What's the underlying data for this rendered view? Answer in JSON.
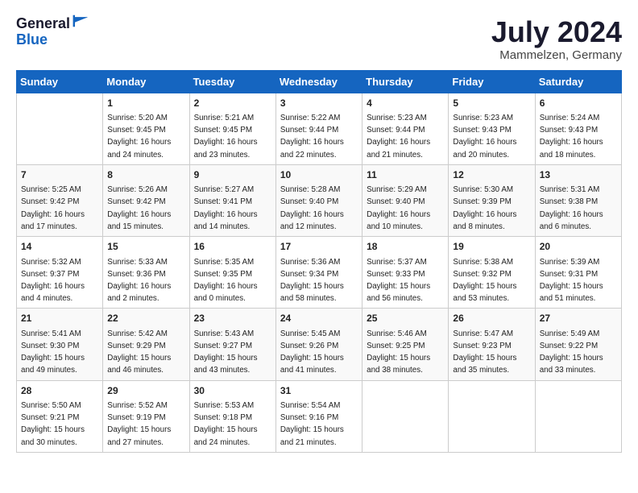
{
  "header": {
    "logo_general": "General",
    "logo_blue": "Blue",
    "month_year": "July 2024",
    "location": "Mammelzen, Germany"
  },
  "days_of_week": [
    "Sunday",
    "Monday",
    "Tuesday",
    "Wednesday",
    "Thursday",
    "Friday",
    "Saturday"
  ],
  "weeks": [
    [
      {
        "date": "",
        "info": ""
      },
      {
        "date": "1",
        "info": "Sunrise: 5:20 AM\nSunset: 9:45 PM\nDaylight: 16 hours\nand 24 minutes."
      },
      {
        "date": "2",
        "info": "Sunrise: 5:21 AM\nSunset: 9:45 PM\nDaylight: 16 hours\nand 23 minutes."
      },
      {
        "date": "3",
        "info": "Sunrise: 5:22 AM\nSunset: 9:44 PM\nDaylight: 16 hours\nand 22 minutes."
      },
      {
        "date": "4",
        "info": "Sunrise: 5:23 AM\nSunset: 9:44 PM\nDaylight: 16 hours\nand 21 minutes."
      },
      {
        "date": "5",
        "info": "Sunrise: 5:23 AM\nSunset: 9:43 PM\nDaylight: 16 hours\nand 20 minutes."
      },
      {
        "date": "6",
        "info": "Sunrise: 5:24 AM\nSunset: 9:43 PM\nDaylight: 16 hours\nand 18 minutes."
      }
    ],
    [
      {
        "date": "7",
        "info": "Sunrise: 5:25 AM\nSunset: 9:42 PM\nDaylight: 16 hours\nand 17 minutes."
      },
      {
        "date": "8",
        "info": "Sunrise: 5:26 AM\nSunset: 9:42 PM\nDaylight: 16 hours\nand 15 minutes."
      },
      {
        "date": "9",
        "info": "Sunrise: 5:27 AM\nSunset: 9:41 PM\nDaylight: 16 hours\nand 14 minutes."
      },
      {
        "date": "10",
        "info": "Sunrise: 5:28 AM\nSunset: 9:40 PM\nDaylight: 16 hours\nand 12 minutes."
      },
      {
        "date": "11",
        "info": "Sunrise: 5:29 AM\nSunset: 9:40 PM\nDaylight: 16 hours\nand 10 minutes."
      },
      {
        "date": "12",
        "info": "Sunrise: 5:30 AM\nSunset: 9:39 PM\nDaylight: 16 hours\nand 8 minutes."
      },
      {
        "date": "13",
        "info": "Sunrise: 5:31 AM\nSunset: 9:38 PM\nDaylight: 16 hours\nand 6 minutes."
      }
    ],
    [
      {
        "date": "14",
        "info": "Sunrise: 5:32 AM\nSunset: 9:37 PM\nDaylight: 16 hours\nand 4 minutes."
      },
      {
        "date": "15",
        "info": "Sunrise: 5:33 AM\nSunset: 9:36 PM\nDaylight: 16 hours\nand 2 minutes."
      },
      {
        "date": "16",
        "info": "Sunrise: 5:35 AM\nSunset: 9:35 PM\nDaylight: 16 hours\nand 0 minutes."
      },
      {
        "date": "17",
        "info": "Sunrise: 5:36 AM\nSunset: 9:34 PM\nDaylight: 15 hours\nand 58 minutes."
      },
      {
        "date": "18",
        "info": "Sunrise: 5:37 AM\nSunset: 9:33 PM\nDaylight: 15 hours\nand 56 minutes."
      },
      {
        "date": "19",
        "info": "Sunrise: 5:38 AM\nSunset: 9:32 PM\nDaylight: 15 hours\nand 53 minutes."
      },
      {
        "date": "20",
        "info": "Sunrise: 5:39 AM\nSunset: 9:31 PM\nDaylight: 15 hours\nand 51 minutes."
      }
    ],
    [
      {
        "date": "21",
        "info": "Sunrise: 5:41 AM\nSunset: 9:30 PM\nDaylight: 15 hours\nand 49 minutes."
      },
      {
        "date": "22",
        "info": "Sunrise: 5:42 AM\nSunset: 9:29 PM\nDaylight: 15 hours\nand 46 minutes."
      },
      {
        "date": "23",
        "info": "Sunrise: 5:43 AM\nSunset: 9:27 PM\nDaylight: 15 hours\nand 43 minutes."
      },
      {
        "date": "24",
        "info": "Sunrise: 5:45 AM\nSunset: 9:26 PM\nDaylight: 15 hours\nand 41 minutes."
      },
      {
        "date": "25",
        "info": "Sunrise: 5:46 AM\nSunset: 9:25 PM\nDaylight: 15 hours\nand 38 minutes."
      },
      {
        "date": "26",
        "info": "Sunrise: 5:47 AM\nSunset: 9:23 PM\nDaylight: 15 hours\nand 35 minutes."
      },
      {
        "date": "27",
        "info": "Sunrise: 5:49 AM\nSunset: 9:22 PM\nDaylight: 15 hours\nand 33 minutes."
      }
    ],
    [
      {
        "date": "28",
        "info": "Sunrise: 5:50 AM\nSunset: 9:21 PM\nDaylight: 15 hours\nand 30 minutes."
      },
      {
        "date": "29",
        "info": "Sunrise: 5:52 AM\nSunset: 9:19 PM\nDaylight: 15 hours\nand 27 minutes."
      },
      {
        "date": "30",
        "info": "Sunrise: 5:53 AM\nSunset: 9:18 PM\nDaylight: 15 hours\nand 24 minutes."
      },
      {
        "date": "31",
        "info": "Sunrise: 5:54 AM\nSunset: 9:16 PM\nDaylight: 15 hours\nand 21 minutes."
      },
      {
        "date": "",
        "info": ""
      },
      {
        "date": "",
        "info": ""
      },
      {
        "date": "",
        "info": ""
      }
    ]
  ]
}
